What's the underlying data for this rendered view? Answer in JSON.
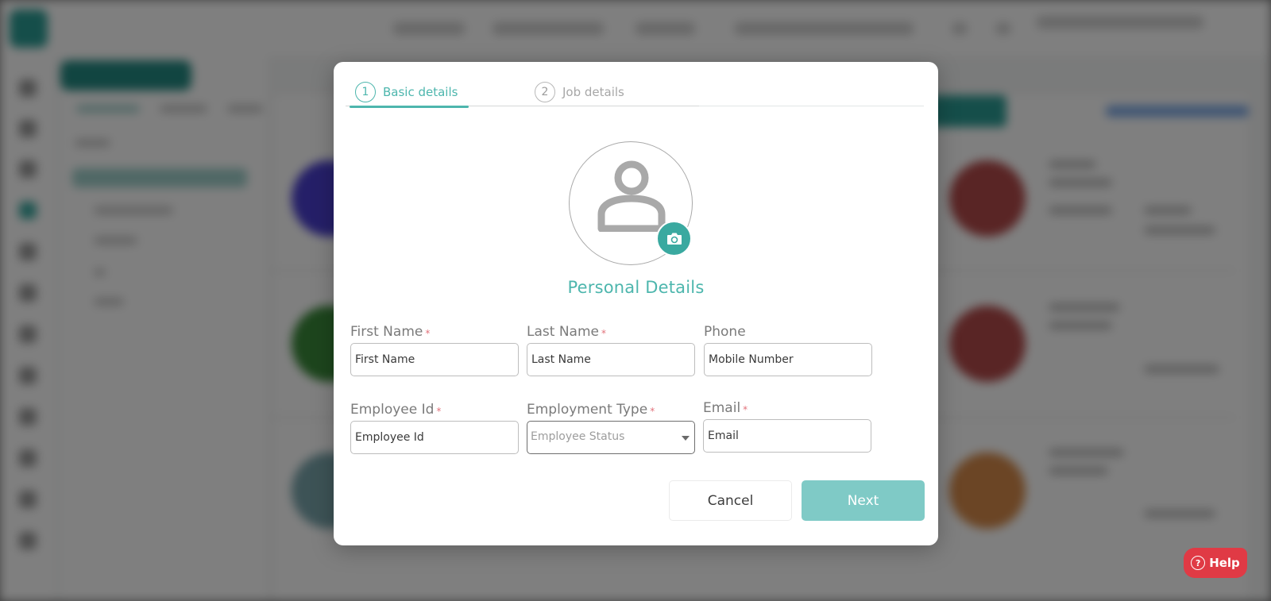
{
  "modal": {
    "steps": [
      {
        "number": "1",
        "label": "Basic details",
        "active": true
      },
      {
        "number": "2",
        "label": "Job details",
        "active": false
      }
    ],
    "section_title": "Personal Details",
    "avatar": {
      "icon": "person-placeholder-icon",
      "upload_icon": "camera-icon"
    },
    "fields": {
      "first_name": {
        "label": "First Name",
        "required_mark": "*",
        "placeholder": "First Name",
        "value": ""
      },
      "last_name": {
        "label": "Last Name",
        "required_mark": "*",
        "placeholder": "Last Name",
        "value": ""
      },
      "phone": {
        "label": "Phone",
        "placeholder": "Mobile Number",
        "value": ""
      },
      "employee_id": {
        "label": "Employee Id",
        "required_mark": "*",
        "placeholder": "Employee Id",
        "value": ""
      },
      "employment_type": {
        "label": "Employment Type",
        "required_mark": "*",
        "placeholder": "Employee Status",
        "selected": ""
      },
      "email": {
        "label": "Email",
        "required_mark": "*",
        "placeholder": "Email",
        "value": ""
      }
    },
    "buttons": {
      "cancel": "Cancel",
      "next": "Next"
    }
  },
  "help": {
    "label": "Help",
    "icon": "?"
  },
  "colors": {
    "accent": "#4db6ad",
    "accent_dark": "#3aa9a0",
    "next_button": "#7fcac6",
    "required": "#e2727b",
    "help_button": "#e03a45",
    "overlay": "rgba(0,0,0,0.5)"
  }
}
